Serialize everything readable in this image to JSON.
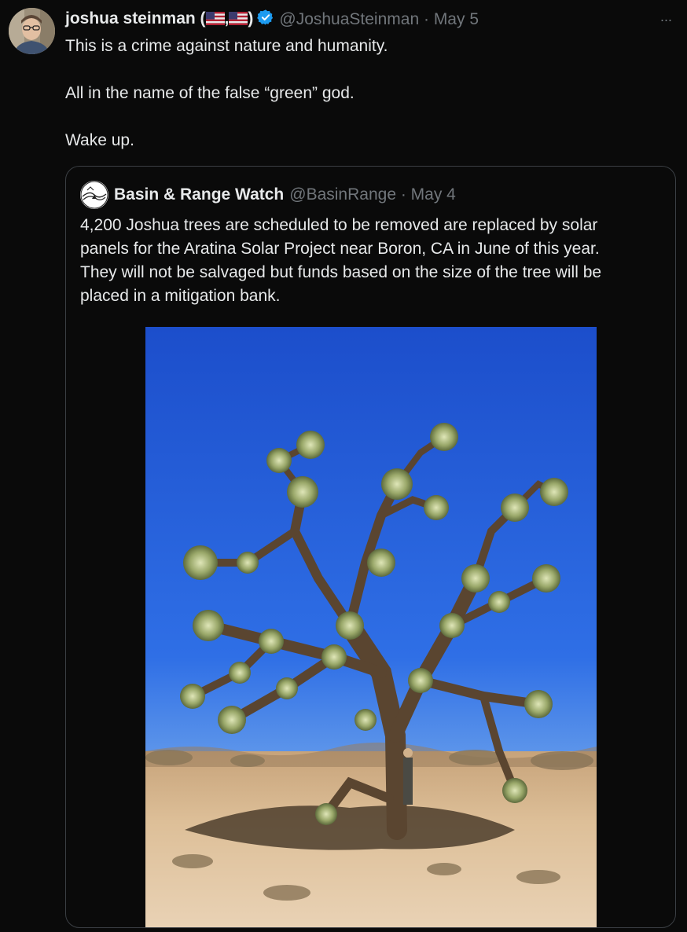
{
  "tweet": {
    "author_name_prefix": "joshua steinman (",
    "author_name_separator": ",",
    "author_name_suffix": ")",
    "author_handle": "@JoshuaSteinman",
    "separator_dot": " · ",
    "date": "May 5",
    "more_label": "···",
    "lines": [
      "This is a crime against nature and humanity.",
      "All in the name of the false “green” god.",
      "Wake up."
    ],
    "flag_icons": [
      "us-flag-icon",
      "us-flag-icon"
    ],
    "verified_icon": "verified-badge-icon"
  },
  "quote": {
    "author_name": "Basin & Range Watch",
    "author_handle": "@BasinRange",
    "separator_dot": " · ",
    "date": "May 4",
    "text_lines": [
      "4,200 Joshua trees are scheduled to be removed are replaced by solar",
      "panels for the Aratina Solar Project near Boron, CA in June of this year.",
      "They will not be salvaged but funds based on the size of the tree will be",
      "placed in a mitigation bank."
    ],
    "image_icon": "joshua-tree-photo"
  },
  "colors": {
    "background": "#0a0a0a",
    "text": "#e7e9ea",
    "muted": "#71767b",
    "verified": "#1d9bf0",
    "border": "#3b3f44"
  }
}
